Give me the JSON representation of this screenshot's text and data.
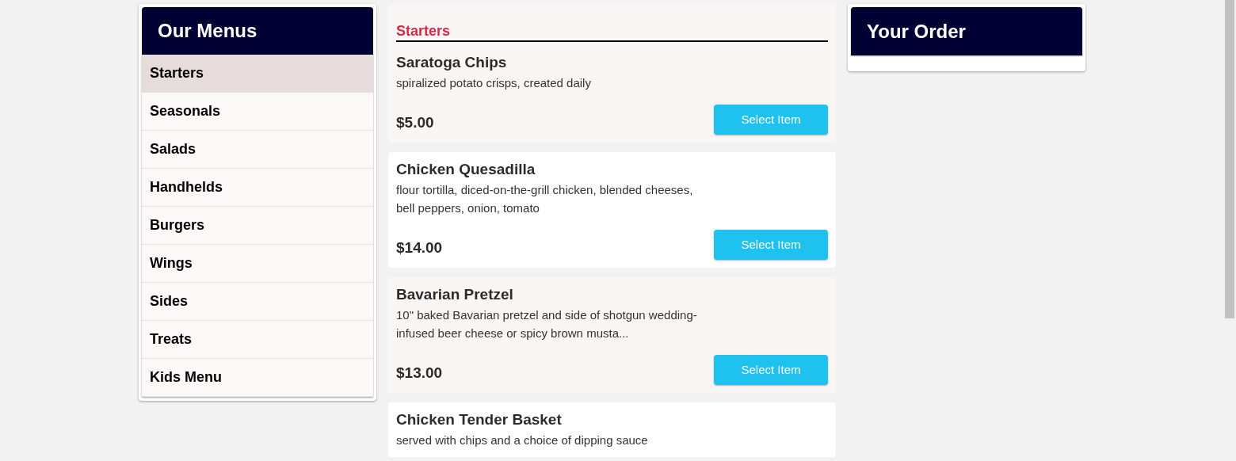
{
  "menus": {
    "title": "Our Menus",
    "items": [
      {
        "label": "Starters",
        "selected": true
      },
      {
        "label": "Seasonals",
        "selected": false
      },
      {
        "label": "Salads",
        "selected": false
      },
      {
        "label": "Handhelds",
        "selected": false
      },
      {
        "label": "Burgers",
        "selected": false
      },
      {
        "label": "Wings",
        "selected": false
      },
      {
        "label": "Sides",
        "selected": false
      },
      {
        "label": "Treats",
        "selected": false
      },
      {
        "label": "Kids Menu",
        "selected": false
      }
    ]
  },
  "section": {
    "heading": "Starters",
    "items": [
      {
        "name": "Saratoga Chips",
        "description": "spiralized potato crisps, created daily",
        "price": "$5.00",
        "button": "Select Item"
      },
      {
        "name": "Chicken Quesadilla",
        "description": "flour tortilla, diced-on-the-grill chicken, blended cheeses, bell peppers, onion, tomato",
        "price": "$14.00",
        "button": "Select Item"
      },
      {
        "name": "Bavarian Pretzel",
        "description": "10\" baked Bavarian pretzel and side of shotgun wedding-infused beer cheese or spicy brown musta...",
        "price": "$13.00",
        "button": "Select Item"
      },
      {
        "name": "Chicken Tender Basket",
        "description": "served with chips and a choice of dipping sauce"
      }
    ]
  },
  "order": {
    "title": "Your Order"
  }
}
